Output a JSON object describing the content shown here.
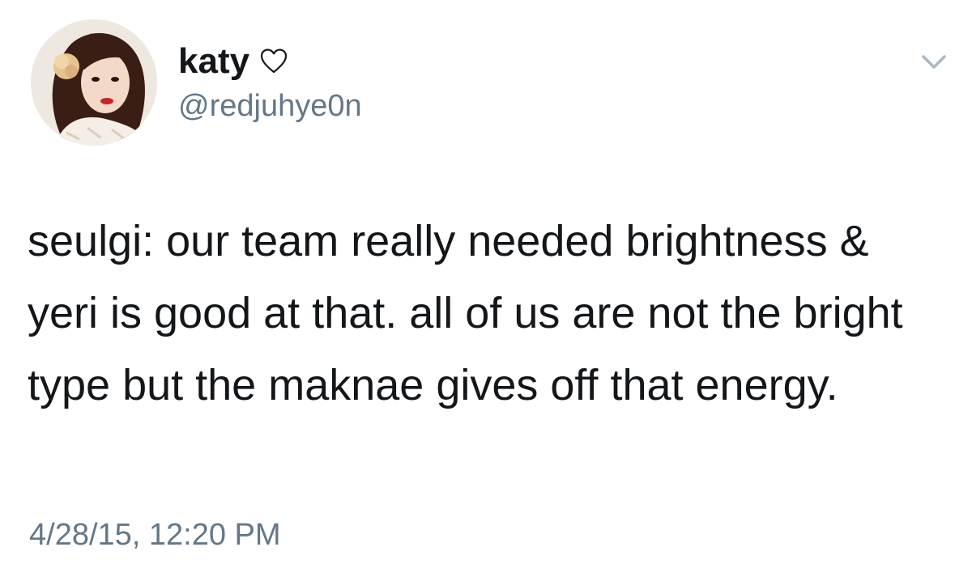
{
  "user": {
    "display_name": "katy",
    "display_name_icon": "heart-outline-icon",
    "handle": "@redjuhye0n",
    "avatar_icon": "profile-photo"
  },
  "tweet": {
    "text": "seulgi: our team really needed brightness & yeri is good at that. all of us are not the bright type but the maknae gives off that energy.",
    "timestamp": "4/28/15, 12:20 PM"
  },
  "controls": {
    "caret_icon": "chevron-down-icon"
  },
  "colors": {
    "text_primary": "#14171a",
    "text_secondary": "#657786",
    "caret": "#aab8c2",
    "background": "#ffffff"
  }
}
